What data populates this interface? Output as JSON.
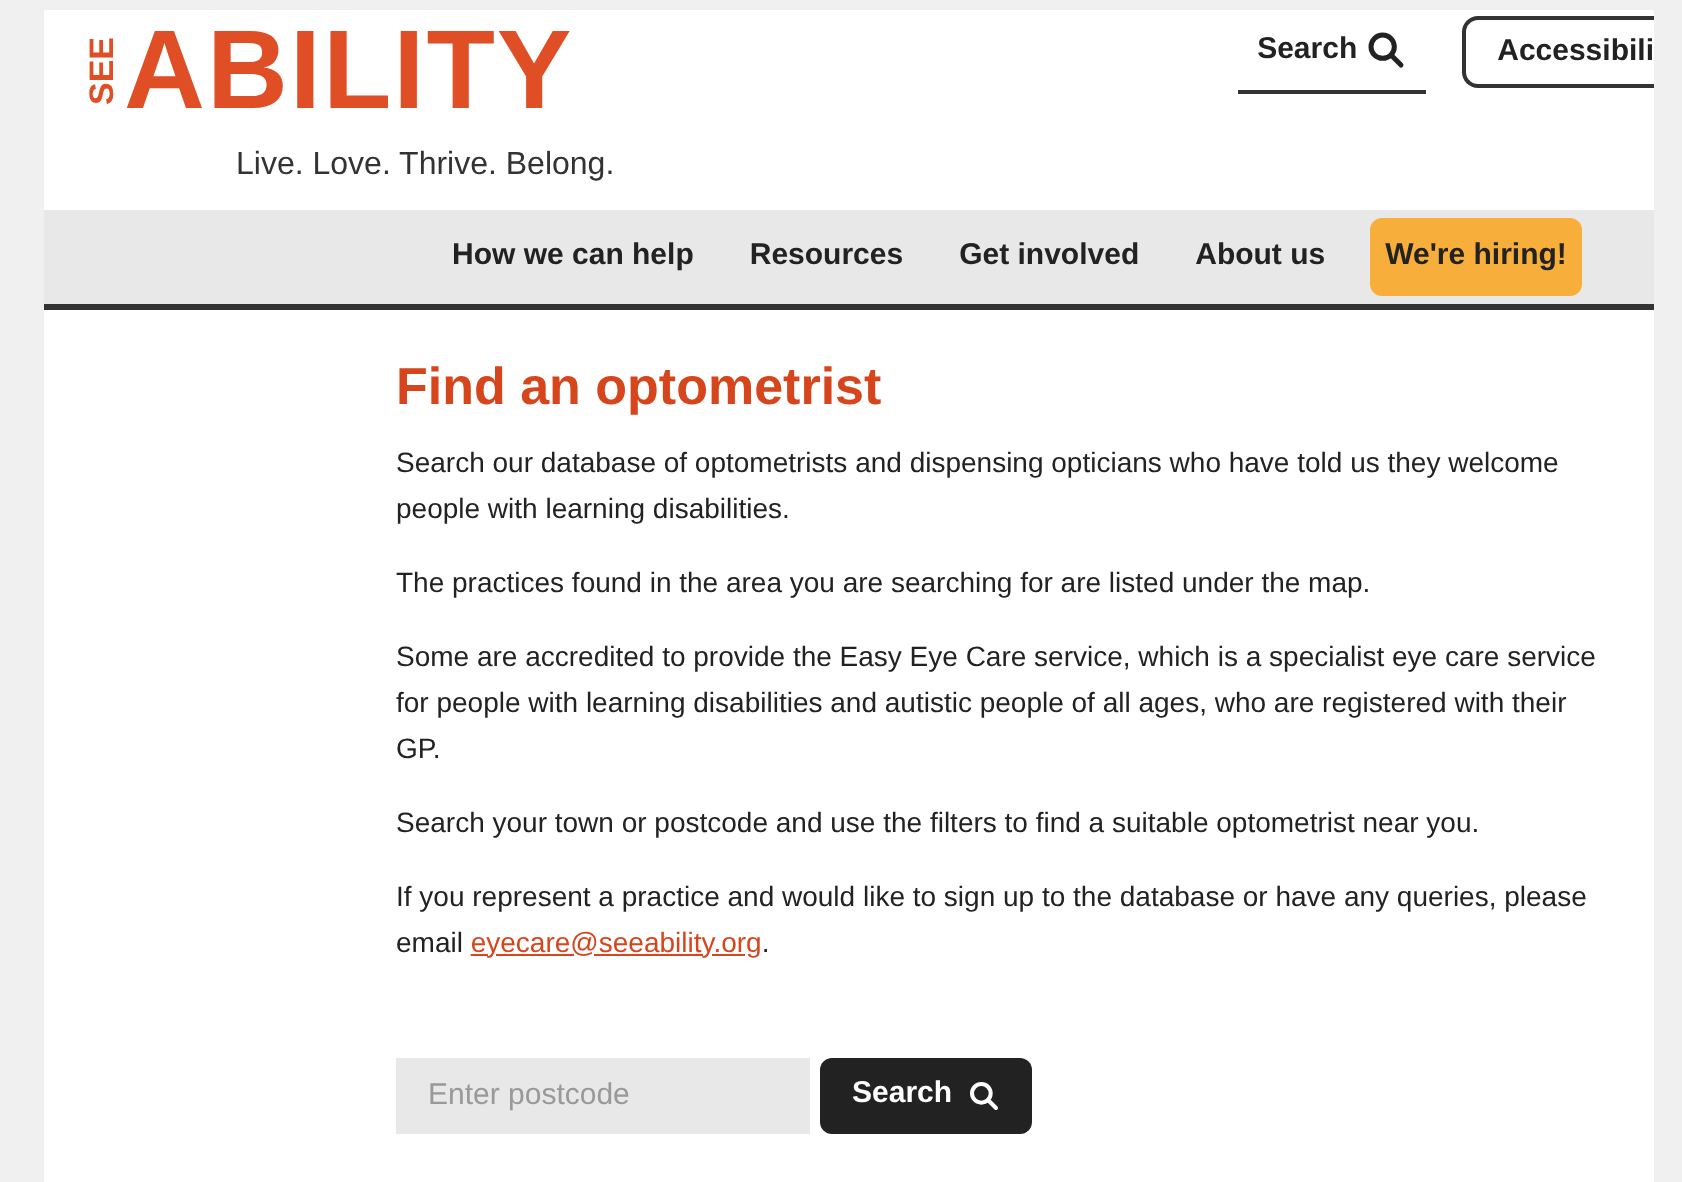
{
  "logo": {
    "side": "SEE",
    "main": "ABILITY",
    "tagline": "Live. Love. Thrive. Belong."
  },
  "header": {
    "search": "Search",
    "accessibility": "Accessibili"
  },
  "nav": [
    {
      "label": "How we can help",
      "kind": "link"
    },
    {
      "label": "Resources",
      "kind": "link"
    },
    {
      "label": "Get involved",
      "kind": "link"
    },
    {
      "label": "About us",
      "kind": "link"
    },
    {
      "label": "We're hiring!",
      "kind": "highlight"
    }
  ],
  "title": "Find an optometrist",
  "paragraphs": [
    {
      "text": "Search our database of optometrists and dispensing opticians who have told us they welcome people with learning disabilities."
    },
    {
      "text": "The practices found in the area you are searching for are listed under the map."
    },
    {
      "text": "Some are accredited to provide the Easy Eye Care service, which is a specialist eye care service for people with learning disabilities and autistic people of all ages, who are registered with their GP."
    },
    {
      "text": "Search your town or postcode and use the filters to find a suitable optometrist near you."
    },
    {
      "text": "If you represent a practice and would like to sign up to the database or have any queries, please email",
      "link": "eyecare@seeability.org",
      "after": "."
    }
  ],
  "search_form": {
    "placeholder": "Enter postcode",
    "button": "Search"
  }
}
